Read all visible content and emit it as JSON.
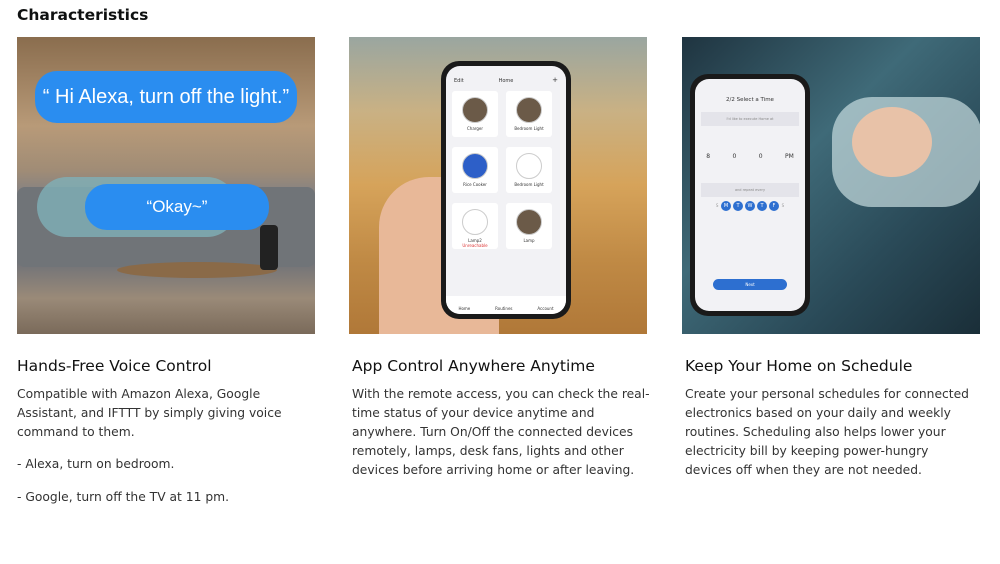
{
  "title": "Characteristics",
  "cards": [
    {
      "heading": "Hands-Free Voice Control",
      "paragraphs": [
        "Compatible with Amazon Alexa, Google Assistant, and IFTTT by simply giving voice command to them.",
        "- Alexa, turn on bedroom.",
        "- Google, turn off the TV at 11 pm."
      ],
      "bubble1": "“ Hi Alexa, turn off the light.”",
      "bubble2": "“Okay~”"
    },
    {
      "heading": "App Control Anywhere Anytime",
      "paragraphs": [
        "With the remote access, you can check the real-time status of your device anytime and anywhere. Turn On/Off the connected devices remotely, lamps, desk fans, lights and other devices before arriving home or after leaving."
      ],
      "app": {
        "edit": "Edit",
        "home": "Home",
        "plus": "+",
        "tiles": [
          "Charger",
          "Bedroom Light",
          "Rice Cooker",
          "Bedroom Light",
          "Lamp2",
          "Lamp"
        ],
        "unreachable": "Unreachable",
        "tabs": [
          "Home",
          "Routines",
          "Account"
        ]
      }
    },
    {
      "heading": "Keep Your Home on Schedule",
      "paragraphs": [
        "Create your personal schedules for connected electronics based on your daily and weekly routines. Scheduling also helps lower your electricity bill by keeping power-hungry devices off when they are not needed."
      ],
      "app": {
        "title": "2/2 Select a Time",
        "prompt": "I'd like to execute Home at",
        "hour": "8",
        "min1": "0",
        "min2": "0",
        "ampm": "PM",
        "repeat": "and repeat every",
        "days": [
          "S",
          "M",
          "T",
          "W",
          "T",
          "F",
          "S"
        ],
        "next": "Next"
      }
    }
  ]
}
